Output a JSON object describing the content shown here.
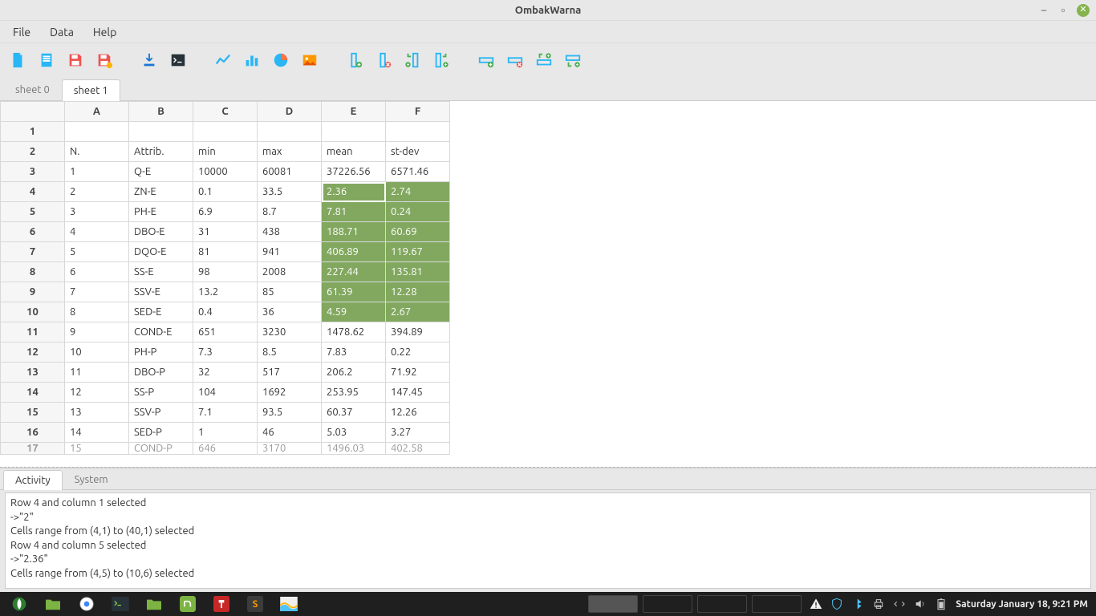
{
  "window": {
    "title": "OmbakWarna"
  },
  "menu": {
    "file": "File",
    "data": "Data",
    "help": "Help"
  },
  "sheet_tabs": {
    "t0": "sheet 0",
    "t1": "sheet 1"
  },
  "columns": [
    "A",
    "B",
    "C",
    "D",
    "E",
    "F"
  ],
  "row_numbers": [
    "1",
    "2",
    "3",
    "4",
    "5",
    "6",
    "7",
    "8",
    "9",
    "10",
    "11",
    "12",
    "13",
    "14",
    "15",
    "16",
    "17"
  ],
  "rows": [
    {
      "A": "",
      "B": "",
      "C": "",
      "D": "",
      "E": "",
      "F": ""
    },
    {
      "A": "N.",
      "B": "Attrib.",
      "C": "min",
      "D": "max",
      "E": "mean",
      "F": "st-dev"
    },
    {
      "A": "1",
      "B": "Q-E",
      "C": "10000",
      "D": "60081",
      "E": "37226.56",
      "F": "6571.46"
    },
    {
      "A": "2",
      "B": "ZN-E",
      "C": "0.1",
      "D": "33.5",
      "E": "2.36",
      "F": "2.74"
    },
    {
      "A": "3",
      "B": "PH-E",
      "C": "6.9",
      "D": "8.7",
      "E": "7.81",
      "F": "0.24"
    },
    {
      "A": "4",
      "B": "DBO-E",
      "C": "31",
      "D": "438",
      "E": "188.71",
      "F": "60.69"
    },
    {
      "A": "5",
      "B": "DQO-E",
      "C": "81",
      "D": "941",
      "E": "406.89",
      "F": "119.67"
    },
    {
      "A": "6",
      "B": "SS-E",
      "C": "98",
      "D": "2008",
      "E": "227.44",
      "F": "135.81"
    },
    {
      "A": "7",
      "B": "SSV-E",
      "C": "13.2",
      "D": "85",
      "E": "61.39",
      "F": "12.28"
    },
    {
      "A": "8",
      "B": "SED-E",
      "C": "0.4",
      "D": "36",
      "E": "4.59",
      "F": "2.67"
    },
    {
      "A": "9",
      "B": "COND-E",
      "C": "651",
      "D": "3230",
      "E": "1478.62",
      "F": "394.89"
    },
    {
      "A": "10",
      "B": "PH-P",
      "C": "7.3",
      "D": "8.5",
      "E": "7.83",
      "F": "0.22"
    },
    {
      "A": "11",
      "B": "DBO-P",
      "C": "32",
      "D": "517",
      "E": "206.2",
      "F": "71.92"
    },
    {
      "A": "12",
      "B": "SS-P",
      "C": "104",
      "D": "1692",
      "E": "253.95",
      "F": "147.45"
    },
    {
      "A": "13",
      "B": "SSV-P",
      "C": "7.1",
      "D": "93.5",
      "E": "60.37",
      "F": "12.26"
    },
    {
      "A": "14",
      "B": "SED-P",
      "C": "1",
      "D": "46",
      "E": "5.03",
      "F": "3.27"
    },
    {
      "A": "15",
      "B": "COND-P",
      "C": "646",
      "D": "3170",
      "E": "1496.03",
      "F": "402.58"
    }
  ],
  "selection": {
    "active_row": 4,
    "active_col": "E",
    "range": {
      "r1": 4,
      "r2": 10,
      "cols": [
        "E",
        "F"
      ]
    }
  },
  "bottom_panel": {
    "tabs": {
      "activity": "Activity",
      "system": "System"
    },
    "log": [
      "Row 4 and column 1 selected",
      "->\"2\"",
      "Cells range from (4,1) to (40,1) selected",
      "Row 4 and column 5 selected",
      "->\"2.36\"",
      "Cells range from (4,5) to (10,6) selected"
    ]
  },
  "taskbar": {
    "clock": "Saturday January 18,  9:21 PM"
  }
}
